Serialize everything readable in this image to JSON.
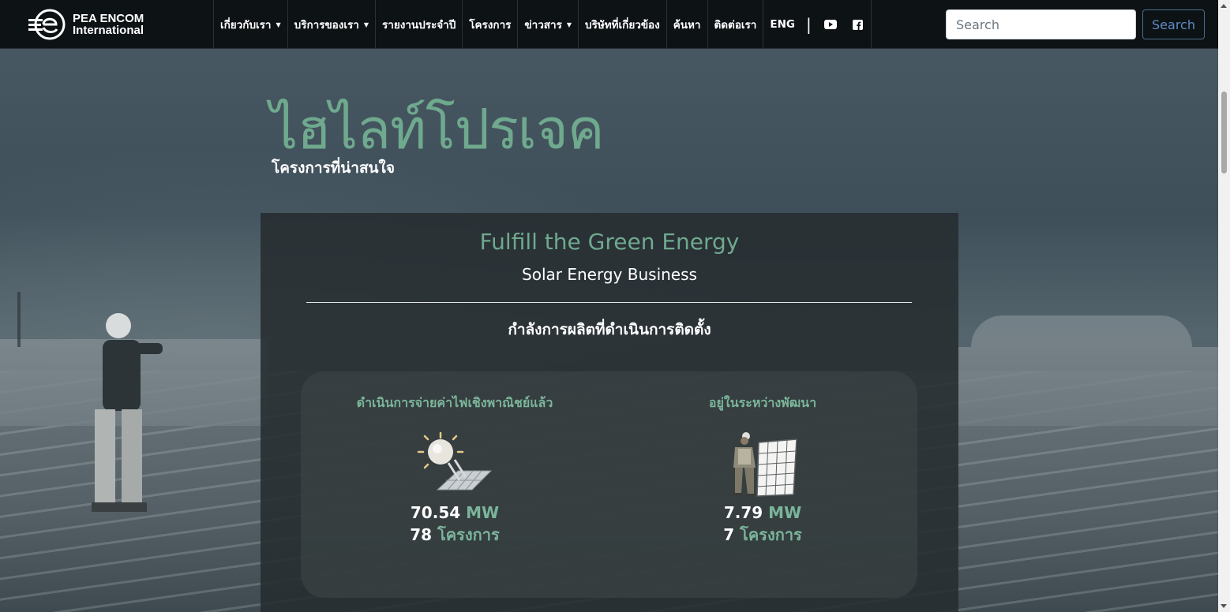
{
  "brand": {
    "name_line1": "PEA ENCOM",
    "name_line2": "International"
  },
  "nav": {
    "items": [
      {
        "label": "เกี่ยวกับเรา",
        "dropdown": true
      },
      {
        "label": "บริการของเรา",
        "dropdown": true
      },
      {
        "label": "รายงานประจำปี",
        "dropdown": false
      },
      {
        "label": "โครงการ",
        "dropdown": false
      },
      {
        "label": "ข่าวสาร",
        "dropdown": true
      },
      {
        "label": "บริษัทที่เกี่ยวข้อง",
        "dropdown": false
      },
      {
        "label": "ค้นหา",
        "dropdown": false
      },
      {
        "label": "ติดต่อเรา",
        "dropdown": false
      },
      {
        "label": "ENG",
        "dropdown": false
      }
    ],
    "separator": "|",
    "social_icons": [
      "youtube-icon",
      "facebook-icon"
    ]
  },
  "search": {
    "placeholder": "Search",
    "button_label": "Search"
  },
  "hero": {
    "title": "ไฮไลท์โปรเจค",
    "subtitle": "โครงการที่น่าสนใจ"
  },
  "card": {
    "title": "Fulfill the Green Energy",
    "subtitle": "Solar Energy Business",
    "capacity_heading": "กำลังการผลิตที่ดำเนินการติดตั้ง"
  },
  "stats": [
    {
      "label": "ดำเนินการจ่ายค่าไฟเชิงพาณิชย์แล้ว",
      "icon": "solar-panel-sun-icon",
      "value": "70.54",
      "unit": "MW",
      "projects": "78",
      "projects_unit": "โครงการ"
    },
    {
      "label": "อยู่ในระหว่างพัฒนา",
      "icon": "worker-installing-panel-icon",
      "value": "7.79",
      "unit": "MW",
      "projects": "7",
      "projects_unit": "โครงการ"
    }
  ],
  "colors": {
    "accent": "#6fa98e",
    "navbar_bg": "#0d1215",
    "search_button": "#5d8cc4"
  }
}
